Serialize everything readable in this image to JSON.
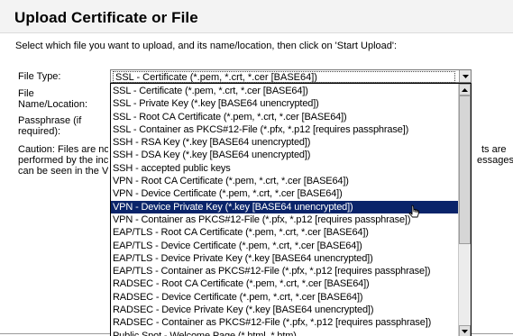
{
  "header": {
    "title": "Upload Certificate or File",
    "intro": "Select which file you want to upload, and its name/location, then click on 'Start Upload':"
  },
  "form": {
    "file_type_label": "File Type:",
    "file_name_label_1": "File",
    "file_name_label_2": "Name/Location:",
    "passphrase_label_1": "Passphrase (if",
    "passphrase_label_2": "required):",
    "selected_value": "SSL - Certificate (*.pem, *.crt, *.cer [BASE64])",
    "caution_line_1": "Caution: Files are no",
    "caution_line_2": "performed by the inc",
    "caution_line_3": "can be seen in the V",
    "caution_right_1": "ts are",
    "caution_right_2": "essages"
  },
  "dropdown": {
    "highlighted_index": 10,
    "options": [
      "SSL - Certificate (*.pem, *.crt, *.cer [BASE64])",
      "SSL - Private Key (*.key [BASE64 unencrypted])",
      "SSL - Root CA Certificate (*.pem, *.crt, *.cer [BASE64])",
      "SSL - Container as PKCS#12-File (*.pfx, *.p12 [requires passphrase])",
      "SSH - RSA Key (*.key [BASE64 unencrypted])",
      "SSH - DSA Key (*.key [BASE64 unencrypted])",
      "SSH - accepted public keys",
      "VPN - Root CA Certificate (*.pem, *.crt, *.cer [BASE64])",
      "VPN - Device Certificate (*.pem, *.crt, *.cer [BASE64])",
      "VPN - Device Private Key (*.key [BASE64 unencrypted])",
      "VPN - Container as PKCS#12-File (*.pfx, *.p12 [requires passphrase])",
      "EAP/TLS - Root CA Certificate (*.pem, *.crt, *.cer [BASE64])",
      "EAP/TLS - Device Certificate (*.pem, *.crt, *.cer [BASE64])",
      "EAP/TLS - Device Private Key (*.key [BASE64 unencrypted])",
      "EAP/TLS - Container as PKCS#12-File (*.pfx, *.p12 [requires passphrase])",
      "RADSEC - Root CA Certificate (*.pem, *.crt, *.cer [BASE64])",
      "RADSEC - Device Certificate (*.pem, *.crt, *.cer [BASE64])",
      "RADSEC - Device Private Key (*.key [BASE64 unencrypted])",
      "RADSEC - Container as PKCS#12-File (*.pfx, *.p12 [requires passphrase])",
      "Public Spot - Welcome Page (*.html, *.htm)"
    ]
  },
  "icons": {
    "select_arrow": "chevron-down-icon",
    "scroll_up": "scroll-up-icon",
    "scroll_down": "scroll-down-icon",
    "cursor": "mouse-pointer-icon"
  },
  "colors": {
    "highlight_bg": "#0a246a",
    "highlight_text": "#ffffff",
    "title_band": "#f3f3f3"
  }
}
